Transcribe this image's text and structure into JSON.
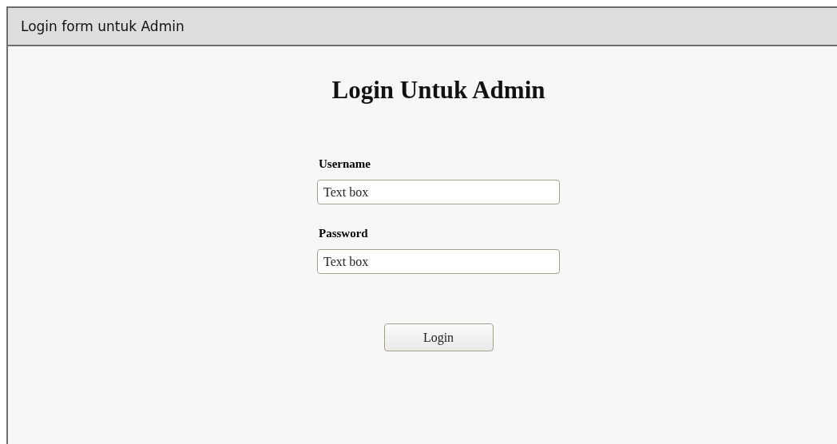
{
  "window": {
    "title": "Login form untuk Admin"
  },
  "heading": "Login Untuk Admin",
  "fields": [
    {
      "label": "Username",
      "value": "Text box"
    },
    {
      "label": "Password",
      "value": "Text box"
    }
  ],
  "button": "Login"
}
